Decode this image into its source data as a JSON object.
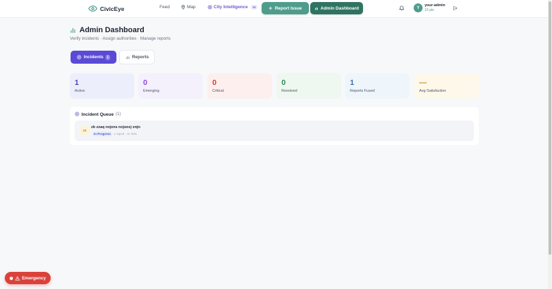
{
  "brand": {
    "name": "CivicEye",
    "icon": "eye-icon",
    "color": "#4e9c8c"
  },
  "nav": {
    "feed": "Feed",
    "map": "Map",
    "city_intelligence": "City Intelligence",
    "ai_badge": "AI"
  },
  "actions": {
    "report_issue": "Report Issue",
    "admin_dashboard": "Admin Dashboard"
  },
  "user": {
    "initial": "Y",
    "name": "your-admin",
    "points": "10 pts"
  },
  "page": {
    "title": "Admin Dashboard",
    "subtitle": "Verify incidents · Assign authorities · Manage reports"
  },
  "tabs": {
    "incidents": {
      "label": "Incidents",
      "count": "1",
      "active": true
    },
    "reports": {
      "label": "Reports",
      "active": false
    }
  },
  "stats": [
    {
      "value": "1",
      "label": "Active",
      "color": "#4a46b8",
      "bg": "#eceefc"
    },
    {
      "value": "0",
      "label": "Emerging",
      "color": "#8b4fd0",
      "bg": "#f4f0fc"
    },
    {
      "value": "0",
      "label": "Critical",
      "color": "#c8423b",
      "bg": "#fcefed"
    },
    {
      "value": "0",
      "label": "Resolved",
      "color": "#2f8a5d",
      "bg": "#eef7f0"
    },
    {
      "value": "1",
      "label": "Reports Fused",
      "color": "#3b6fa8",
      "bg": "#eef5fb"
    },
    {
      "value": "—",
      "label": "Avg Satisfaction",
      "color": "#c98a2a",
      "bg": "#fdf8e9"
    }
  ],
  "queue": {
    "title": "Incident Queue",
    "count": "(1)",
    "incidents": [
      {
        "score": "15",
        "title": "zb zzaq nxjxns nxjsnxj xnjn",
        "status": "In Progress",
        "meta": "1 report · AI 75%"
      }
    ]
  },
  "emergency": {
    "label": "Emergency"
  }
}
